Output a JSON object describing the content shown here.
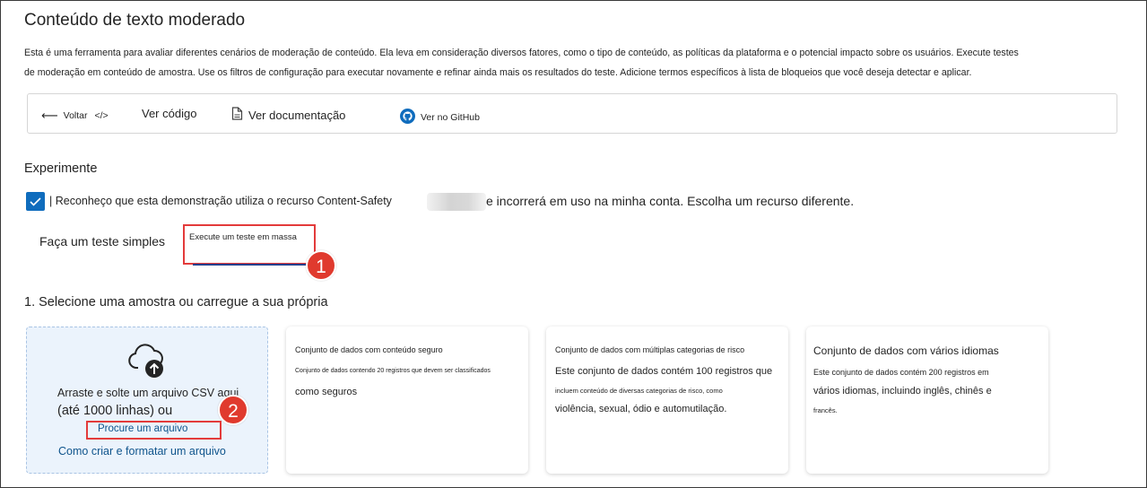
{
  "page": {
    "title": "Conteúdo de texto moderado",
    "description_line1": "Esta é uma ferramenta para avaliar diferentes cenários de moderação de conteúdo. Ela leva em consideração diversos fatores, como o tipo de conteúdo, as políticas da plataforma e o potencial impacto sobre os usuários. Execute testes",
    "description_line2": "de moderação em conteúdo de amostra. Use os filtros de configuração para executar novamente e refinar ainda mais os resultados do teste. Adicione termos específicos à lista de bloqueios que você deseja detectar e aplicar."
  },
  "toolbar": {
    "back_label": "Voltar",
    "code_label": "Ver código",
    "docs_label": "Ver documentação",
    "github_label": "Ver no GitHub"
  },
  "experiment": {
    "heading": "Experimente",
    "ack_part1": "| Reconheço que esta demonstração utiliza o recurso Content-Safety",
    "ack_part2": "e incorrerá em uso na minha conta. Escolha um recurso diferente.",
    "checked": true
  },
  "tabs": [
    {
      "label": "Faça um teste simples",
      "selected": false
    },
    {
      "label": "Execute um teste em massa",
      "selected": true
    }
  ],
  "callouts": {
    "one": "1",
    "two": "2"
  },
  "section": {
    "heading": "1. Selecione uma amostra ou carregue a sua própria"
  },
  "upload": {
    "line1": "Arraste e solte um arquivo CSV aqui",
    "line2": "(até 1000 linhas) ou",
    "browse_label": "Procure um arquivo",
    "howto_label": "Como criar e formatar um arquivo"
  },
  "cards": [
    {
      "title": "Conjunto de dados com conteúdo seguro",
      "lines": [
        "Conjunto de dados contendo 20 registros que devem ser classificados",
        "como seguros"
      ]
    },
    {
      "title": "Conjunto de dados com múltiplas categorias de risco",
      "lines": [
        "Este conjunto de dados contém 100 registros que",
        "incluem conteúdo de diversas categorias de risco, como",
        "violência, sexual, ódio e automutilação."
      ]
    },
    {
      "title": "Conjunto de dados com vários idiomas",
      "lines": [
        "Este conjunto de dados contém 200 registros em",
        "vários idiomas, incluindo inglês, chinês e",
        "francês."
      ]
    }
  ],
  "colors": {
    "accent": "#0f6cbd",
    "link": "#0f548c",
    "highlight": "#e33b3b",
    "upload_bg": "#ebf3fc"
  },
  "icons": [
    "arrow-left-icon",
    "code-icon",
    "document-icon",
    "github-icon",
    "cloud-upload-icon",
    "checkmark-icon"
  ]
}
